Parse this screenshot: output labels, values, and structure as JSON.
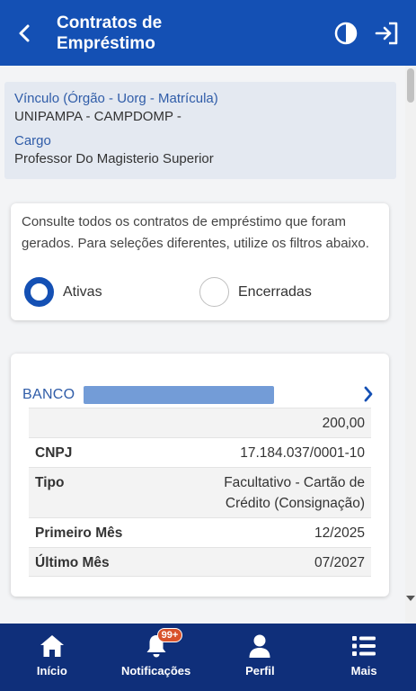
{
  "header": {
    "title_line1": "Contratos de",
    "title_line2": "Empréstimo"
  },
  "vinculo": {
    "vinculo_label": "Vínculo (Órgão - Uorg - Matrícula)",
    "vinculo_value": "UNIPAMPA - CAMPDOMP -",
    "cargo_label": "Cargo",
    "cargo_value": "Professor Do Magisterio Superior"
  },
  "filter": {
    "description": "Consulte todos os contratos de empréstimo que foram gerados. Para seleções diferentes, utilize os filtros abaixo.",
    "options": [
      {
        "label": "Ativas",
        "selected": true
      },
      {
        "label": "Encerradas",
        "selected": false
      }
    ]
  },
  "contract": {
    "bank_label": "BANCO",
    "amount": "200,00",
    "rows": [
      {
        "key": "CNPJ",
        "value": "17.184.037/0001-10"
      },
      {
        "key": "Tipo",
        "value_line1": "Facultativo - Cartão de",
        "value_line2": "Crédito (Consignação)"
      },
      {
        "key": "Primeiro Mês",
        "value": "12/2025"
      },
      {
        "key": "Último Mês",
        "value": "07/2027"
      }
    ]
  },
  "bottom_nav": {
    "items": [
      {
        "label": "Início",
        "icon": "home-icon"
      },
      {
        "label": "Notificações",
        "icon": "bell-icon",
        "badge": "99+"
      },
      {
        "label": "Perfil",
        "icon": "user-icon"
      },
      {
        "label": "Mais",
        "icon": "menu-list-icon"
      }
    ]
  },
  "colors": {
    "primary": "#1450b4",
    "nav_bg": "#0f2f7a",
    "link": "#2f5ca8",
    "badge": "#d9532c"
  }
}
